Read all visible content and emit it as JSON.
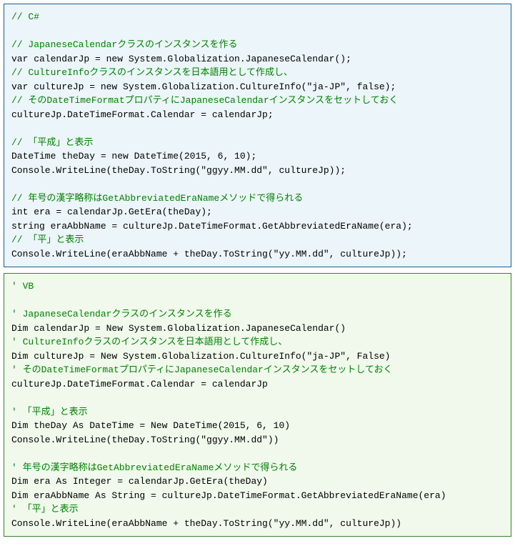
{
  "csharp": {
    "lines": [
      {
        "text": "// C#",
        "cls": "comment"
      },
      {
        "text": "",
        "cls": "code"
      },
      {
        "text": "// JapaneseCalendarクラスのインスタンスを作る",
        "cls": "comment"
      },
      {
        "text": "var calendarJp = new System.Globalization.JapaneseCalendar();",
        "cls": "code"
      },
      {
        "text": "// CultureInfoクラスのインスタンスを日本語用として作成し、",
        "cls": "comment"
      },
      {
        "text": "var cultureJp = new System.Globalization.CultureInfo(\"ja-JP\", false);",
        "cls": "code"
      },
      {
        "text": "// そのDateTimeFormatプロパティにJapaneseCalendarインスタンスをセットしておく",
        "cls": "comment"
      },
      {
        "text": "cultureJp.DateTimeFormat.Calendar = calendarJp;",
        "cls": "code"
      },
      {
        "text": "",
        "cls": "code"
      },
      {
        "text": "// 「平成」と表示",
        "cls": "comment"
      },
      {
        "text": "DateTime theDay = new DateTime(2015, 6, 10);",
        "cls": "code"
      },
      {
        "text": "Console.WriteLine(theDay.ToString(\"ggyy.MM.dd\", cultureJp));",
        "cls": "code"
      },
      {
        "text": "",
        "cls": "code"
      },
      {
        "text": "// 年号の漢字略称はGetAbbreviatedEraNameメソッドで得られる",
        "cls": "comment"
      },
      {
        "text": "int era = calendarJp.GetEra(theDay);",
        "cls": "code"
      },
      {
        "text": "string eraAbbName = cultureJp.DateTimeFormat.GetAbbreviatedEraName(era);",
        "cls": "code"
      },
      {
        "text": "// 「平」と表示",
        "cls": "comment"
      },
      {
        "text": "Console.WriteLine(eraAbbName + theDay.ToString(\"yy.MM.dd\", cultureJp));",
        "cls": "code"
      }
    ]
  },
  "vb": {
    "lines": [
      {
        "text": "' VB",
        "cls": "comment"
      },
      {
        "text": "",
        "cls": "code"
      },
      {
        "text": "' JapaneseCalendarクラスのインスタンスを作る",
        "cls": "comment"
      },
      {
        "text": "Dim calendarJp = New System.Globalization.JapaneseCalendar()",
        "cls": "code"
      },
      {
        "text": "' CultureInfoクラスのインスタンスを日本語用として作成し、",
        "cls": "comment"
      },
      {
        "text": "Dim cultureJp = New System.Globalization.CultureInfo(\"ja-JP\", False)",
        "cls": "code"
      },
      {
        "text": "' そのDateTimeFormatプロパティにJapaneseCalendarインスタンスをセットしておく",
        "cls": "comment"
      },
      {
        "text": "cultureJp.DateTimeFormat.Calendar = calendarJp",
        "cls": "code"
      },
      {
        "text": "",
        "cls": "code"
      },
      {
        "text": "' 「平成」と表示",
        "cls": "comment"
      },
      {
        "text": "Dim theDay As DateTime = New DateTime(2015, 6, 10)",
        "cls": "code"
      },
      {
        "text": "Console.WriteLine(theDay.ToString(\"ggyy.MM.dd\"))",
        "cls": "code"
      },
      {
        "text": "",
        "cls": "code"
      },
      {
        "text": "' 年号の漢字略称はGetAbbreviatedEraNameメソッドで得られる",
        "cls": "comment"
      },
      {
        "text": "Dim era As Integer = calendarJp.GetEra(theDay)",
        "cls": "code"
      },
      {
        "text": "Dim eraAbbName As String = cultureJp.DateTimeFormat.GetAbbreviatedEraName(era)",
        "cls": "code"
      },
      {
        "text": "' 「平」と表示",
        "cls": "comment"
      },
      {
        "text": "Console.WriteLine(eraAbbName + theDay.ToString(\"yy.MM.dd\", cultureJp))",
        "cls": "code"
      }
    ]
  }
}
